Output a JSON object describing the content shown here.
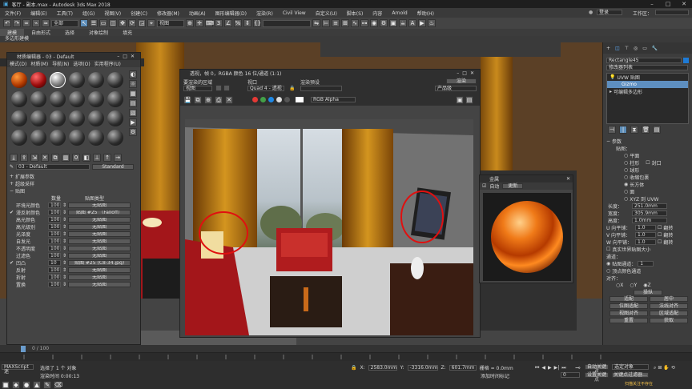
{
  "app": {
    "title": "客厅 - 副本.max - Autodesk 3ds Max 2018",
    "signin": "登录",
    "workspace_label": "工作区："
  },
  "menu": [
    "文件(F)",
    "编辑(E)",
    "工具(T)",
    "组(G)",
    "视图(V)",
    "创建(C)",
    "修改器(M)",
    "动画(A)",
    "图形编辑器(D)",
    "渲染(R)",
    "Civil View",
    "自定义(U)",
    "脚本(S)",
    "内容",
    "Arnold",
    "帮助(H)"
  ],
  "toolbar": {
    "filter_select": "全部",
    "view_select": "视图"
  },
  "tabs": [
    "建模",
    "自由形式",
    "选择",
    "对象绘制",
    "填充"
  ],
  "ribbon_label": "多边形建模",
  "material_editor": {
    "title": "材质编辑器 - 03 - Default",
    "menu": [
      "模式(D)",
      "材质(M)",
      "导航(N)",
      "选项(O)",
      "实用程序(U)"
    ],
    "mat_name": "03 - Default",
    "mat_type": "Standard",
    "rollouts": [
      "扩展参数",
      "超级采样",
      "贴图"
    ],
    "col_amount": "数量",
    "col_map": "贴图类型",
    "maps": [
      {
        "check": "",
        "name": "环境光颜色",
        "amount": "100",
        "map": "无贴图"
      },
      {
        "check": "✔",
        "name": "漫反射颜色",
        "amount": "100",
        "map": "贴图 #25 （Falloff）"
      },
      {
        "check": "",
        "name": "高光颜色",
        "amount": "100",
        "map": "无贴图"
      },
      {
        "check": "",
        "name": "高光级别",
        "amount": "100",
        "map": "无贴图"
      },
      {
        "check": "",
        "name": "光泽度",
        "amount": "100",
        "map": "无贴图"
      },
      {
        "check": "",
        "name": "自发光",
        "amount": "100",
        "map": "无贴图"
      },
      {
        "check": "",
        "name": "不透明度",
        "amount": "100",
        "map": "无贴图"
      },
      {
        "check": "",
        "name": "过滤色",
        "amount": "100",
        "map": "无贴图"
      },
      {
        "check": "✔",
        "name": "凹凸",
        "amount": "10",
        "map": "贴图 #25 (C8-34.jpg)"
      },
      {
        "check": "",
        "name": "反射",
        "amount": "100",
        "map": "无贴图"
      },
      {
        "check": "",
        "name": "折射",
        "amount": "100",
        "map": "无贴图"
      },
      {
        "check": "",
        "name": "置换",
        "amount": "100",
        "map": "无贴图"
      }
    ]
  },
  "render_window": {
    "title": "透视，帧 0，RGBA 颜色 16 位/通道 (1:1)",
    "area_label": "要渲染的区域",
    "area_value": "视图",
    "viewport_label": "视口",
    "viewport_value": "Quad 4 - 透视",
    "preset_label": "渲染预设",
    "preset_value": "",
    "render_button": "渲染",
    "product_select": "产品级",
    "channel_select": "RGB Alpha"
  },
  "preview": {
    "title": "金属",
    "auto_label": "自动",
    "update_button": "更新"
  },
  "command_panel": {
    "object_name": "Rectangle45",
    "modifier_list": "修改器列表",
    "stack": [
      "UVW 贴图",
      "Gizmo",
      "可编辑多边形"
    ],
    "params_title": "参数",
    "mapping_label": "贴图：",
    "mapping_options": [
      "平面",
      "柱形",
      "球形",
      "收缩包裹",
      "长方体",
      "面",
      "XYZ 到 UVW"
    ],
    "cap_label": "封口",
    "length_label": "长度：",
    "length": "251.0mm",
    "width_label": "宽度：",
    "width": "305.9mm",
    "height_label": "高度：",
    "height": "1.0mm",
    "u_label": "U 向平铺：",
    "u": "1.0",
    "v_label": "V 向平铺：",
    "v": "1.0",
    "w_label": "W 向平铺：",
    "w": "1.0",
    "flip_label": "翻转",
    "realworld_label": "真实世界贴图大小",
    "channel_title": "通道：",
    "map_channel_label": "贴图通道：",
    "map_channel": "1",
    "vertex_channel_label": "顶点颜色通道",
    "align_title": "对齐：",
    "align_axes": [
      "X",
      "Y",
      "Z"
    ],
    "align_buttons": [
      "操纵",
      "适配",
      "居中",
      "位图适配",
      "法线对齐",
      "视图对齐",
      "区域适配",
      "重置",
      "获取"
    ]
  },
  "status": {
    "script_label": "MAXScript 迷",
    "selected": "选择了 1 个 对象",
    "render_time": "渲染时间  0:00:13",
    "x": "2583.0mm",
    "y": "-3316.0mm",
    "z": "601.7mm",
    "grid": "栅格 = 0.0mm",
    "add_time_tag": "添加时间标记",
    "autokey": "自动关键点",
    "setkey": "设置关键点",
    "selected_obj": "选定对象",
    "key_filter": "关键点过滤器...",
    "frame": "0",
    "timeline": "0 / 100",
    "watermark": "扫描关注不存在"
  }
}
